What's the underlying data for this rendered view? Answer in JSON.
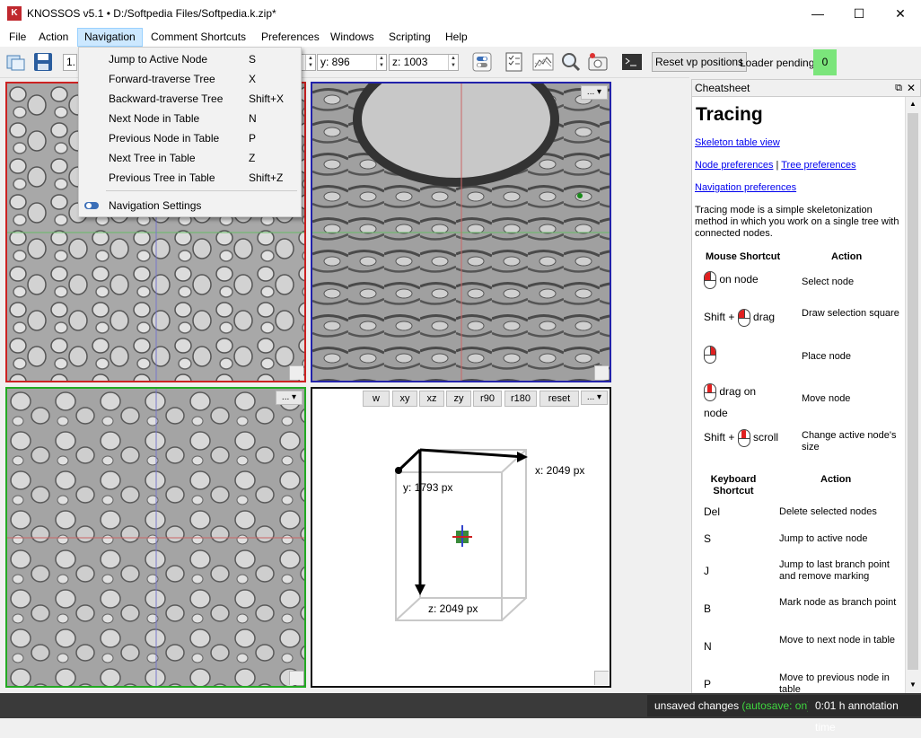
{
  "window": {
    "icon_text": "K",
    "title": "KNOSSOS v5.1 • D:/Softpedia Files/Softpedia.k.zip*",
    "minimize_glyph": "—",
    "maximize_glyph": "☐",
    "close_glyph": "✕"
  },
  "menubar": {
    "items": [
      "File",
      "Action",
      "Navigation",
      "Comment Shortcuts",
      "Preferences",
      "Windows",
      "Scripting",
      "Help"
    ],
    "active": "Navigation"
  },
  "navigation_menu": {
    "items": [
      {
        "label": "Jump to Active Node",
        "shortcut": "S"
      },
      {
        "label": "Forward-traverse Tree",
        "shortcut": "X"
      },
      {
        "label": "Backward-traverse Tree",
        "shortcut": "Shift+X"
      },
      {
        "label": "Next Node in Table",
        "shortcut": "N"
      },
      {
        "label": "Previous Node in Table",
        "shortcut": "P"
      },
      {
        "label": "Next Tree in Table",
        "shortcut": "Z"
      },
      {
        "label": "Previous Tree in Table",
        "shortcut": "Shift+Z"
      },
      {
        "label": "Navigation Settings",
        "shortcut": ""
      }
    ]
  },
  "toolbar": {
    "zoom_prefix": "1.",
    "y_coord": "y: 896",
    "z_coord": "z: 1003",
    "reset_vp_label": "Reset vp positions",
    "loader_label": "Loader pending:",
    "loader_value": "0",
    "loader_color": "#7be57b"
  },
  "viewports": {
    "menu_label": "... ▾",
    "colors": {
      "xy": "#cc2222",
      "xz": "#2222aa",
      "zy": "#22aa22"
    },
    "v3d_buttons": [
      "w",
      "xy",
      "xz",
      "zy",
      "r90",
      "r180",
      "reset"
    ],
    "v3d_labels": {
      "x": "x: 2049 px",
      "y": "y: 1793 px",
      "z": "z: 2049 px"
    }
  },
  "cheatsheet": {
    "panel_title": "Cheatsheet",
    "heading": "Tracing",
    "link_table": "Skeleton table view",
    "link_node": "Node preferences",
    "link_sep": "|",
    "link_tree": "Tree preferences",
    "link_nav": "Navigation preferences",
    "description": "Tracing mode is a simple skeletonization method in which you work on a single tree with connected nodes.",
    "mouse_header": [
      "Mouse Shortcut",
      "Action"
    ],
    "mouse_rows": [
      {
        "prefix": "",
        "suffix": "on node",
        "action": "Select node"
      },
      {
        "prefix": "Shift +",
        "suffix": "drag",
        "action": "Draw selection square"
      },
      {
        "prefix": "",
        "suffix": "",
        "action": "Place node"
      },
      {
        "prefix": "",
        "suffix": "drag on node",
        "action": "Move node"
      },
      {
        "prefix": "Shift +",
        "suffix": "scroll",
        "action": "Change active node's size"
      }
    ],
    "kb_header": [
      "Keyboard Shortcut",
      "Action"
    ],
    "kb_rows": [
      {
        "key": "Del",
        "action": "Delete selected nodes"
      },
      {
        "key": "S",
        "action": "Jump to active node"
      },
      {
        "key": "J",
        "action": "Jump to last branch point and remove marking"
      },
      {
        "key": "B",
        "action": "Mark node as branch point"
      },
      {
        "key": "N",
        "action": "Move to next node in table"
      },
      {
        "key": "P",
        "action": "Move to previous node in table"
      }
    ]
  },
  "statusbar": {
    "unsaved": "unsaved changes",
    "autosave": "(autosave: on)",
    "autosave_color": "#3fd63f",
    "time": "0:01 h annotation time"
  }
}
